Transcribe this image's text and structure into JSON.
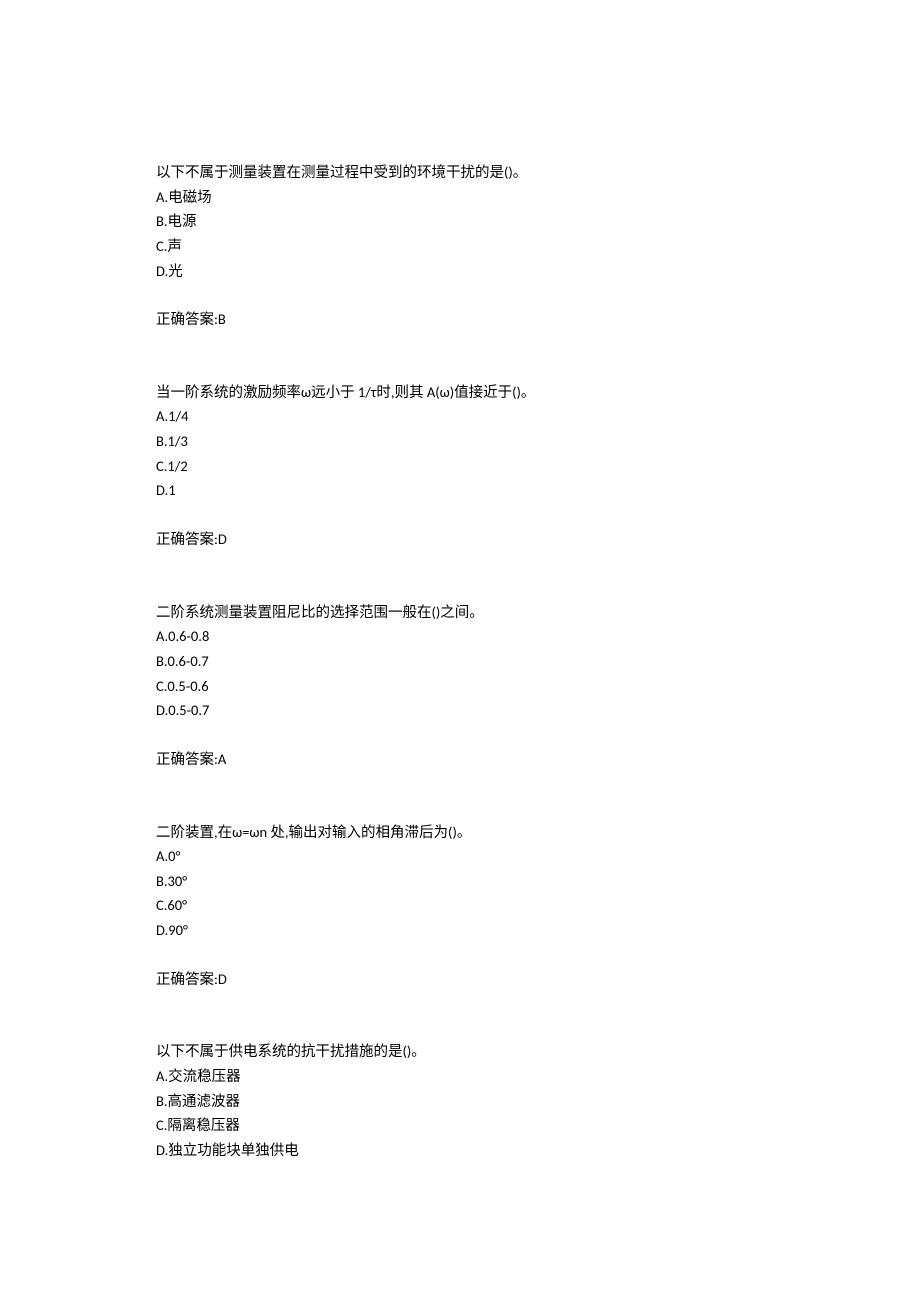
{
  "answer_label": "正确答案:",
  "questions": [
    {
      "stem": "以下不属于测量装置在测量过程中受到的环境干扰的是()。",
      "options": [
        "A.电磁场",
        "B.电源",
        "C.声",
        "D.光"
      ],
      "answer": "B"
    },
    {
      "stem": "当一阶系统的激励频率ω远小于 1/τ时,则其 A(ω)值接近于()。",
      "options": [
        "A.1/4",
        "B.1/3",
        "C.1/2",
        "D.1"
      ],
      "answer": "D"
    },
    {
      "stem": "二阶系统测量装置阻尼比的选择范围一般在()之间。",
      "options": [
        "A.0.6-0.8",
        "B.0.6-0.7",
        "C.0.5-0.6",
        "D.0.5-0.7"
      ],
      "answer": "A"
    },
    {
      "stem": "二阶装置,在ω=ωn 处,输出对输入的相角滞后为()。",
      "options": [
        "A.0°",
        "B.30°",
        "C.60°",
        "D.90°"
      ],
      "answer": "D"
    },
    {
      "stem": "以下不属于供电系统的抗干扰措施的是()。",
      "options": [
        "A.交流稳压器",
        "B.高通滤波器",
        "C.隔离稳压器",
        "D.独立功能块单独供电"
      ],
      "answer": ""
    }
  ]
}
